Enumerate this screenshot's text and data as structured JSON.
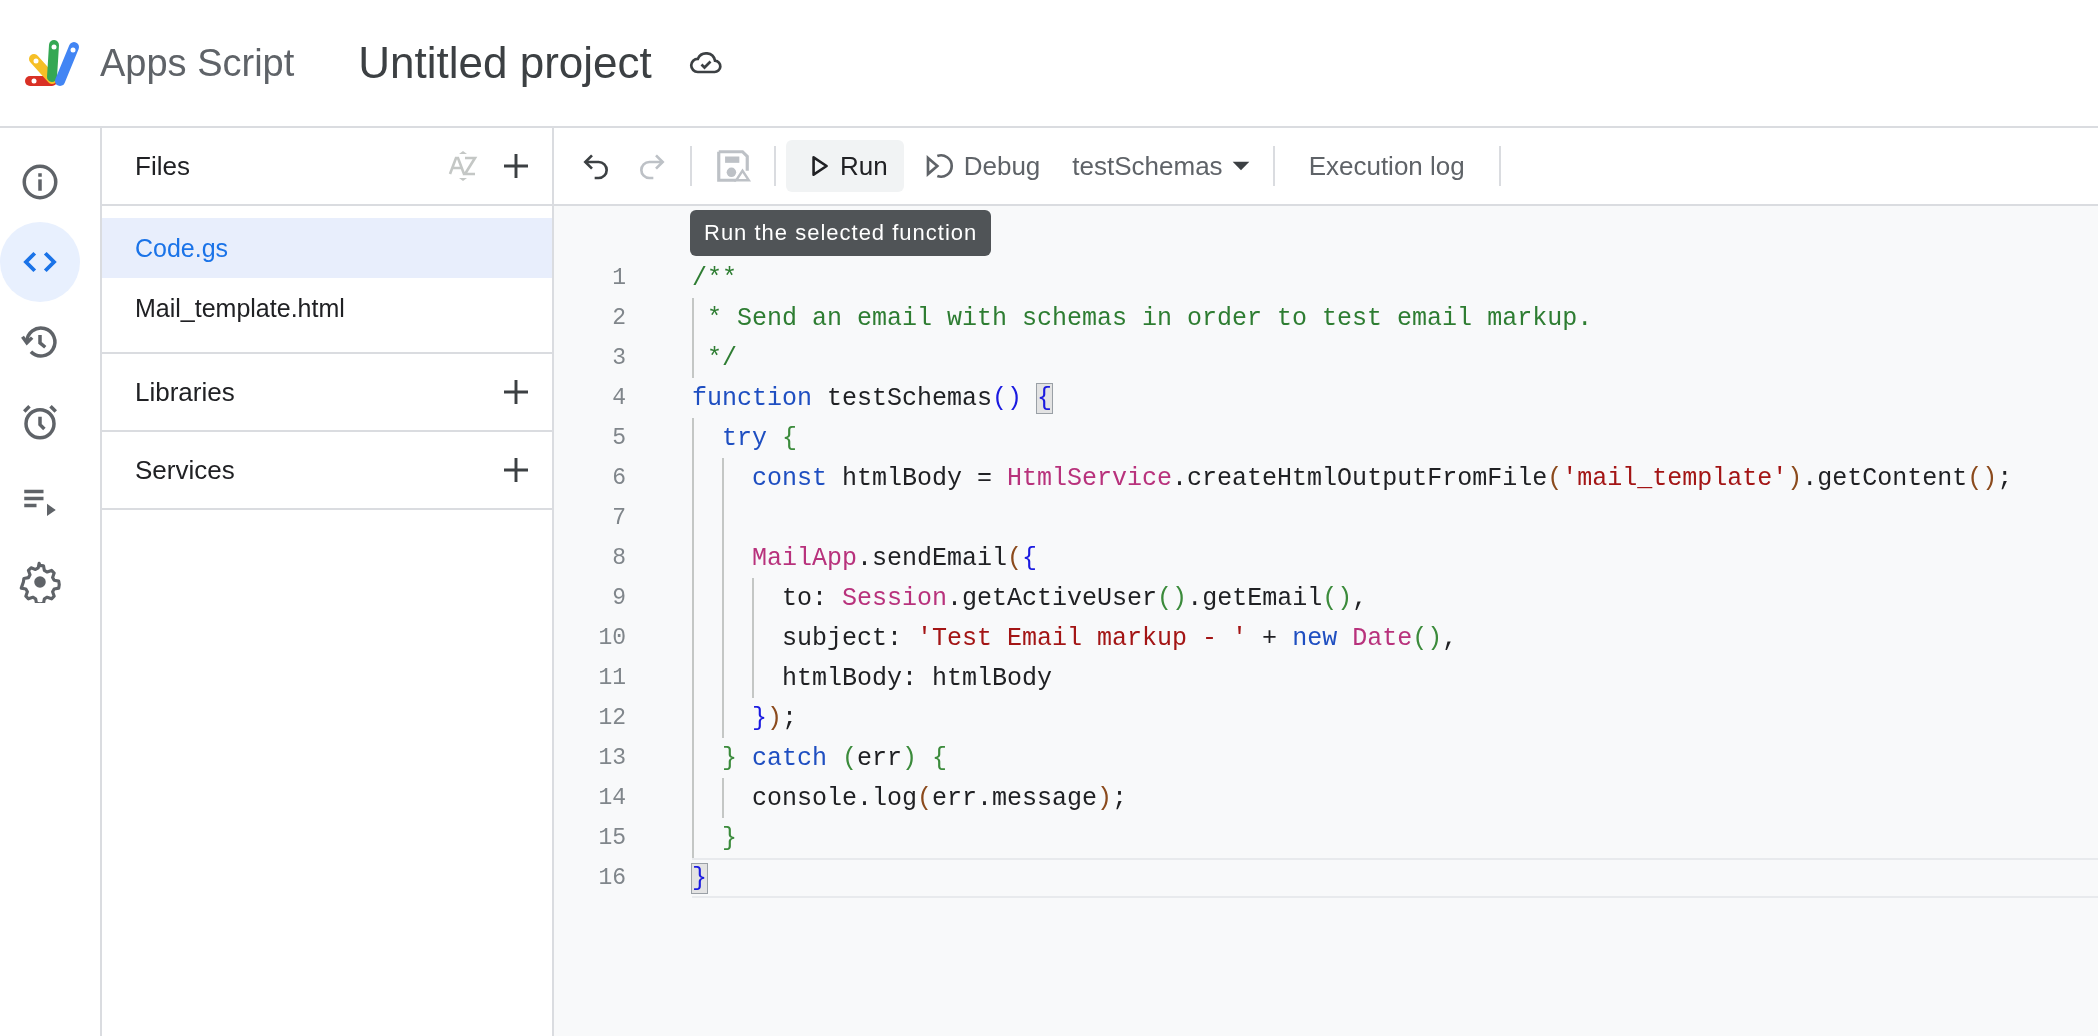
{
  "header": {
    "app_name": "Apps Script",
    "project_title": "Untitled project"
  },
  "rail": [
    {
      "kind": "info",
      "selected": false
    },
    {
      "kind": "code",
      "selected": true
    },
    {
      "kind": "history",
      "selected": false
    },
    {
      "kind": "triggers",
      "selected": false
    },
    {
      "kind": "executions",
      "selected": false
    },
    {
      "kind": "settings",
      "selected": false
    }
  ],
  "files_panel": {
    "title": "Files",
    "files": [
      {
        "name": "Code.gs",
        "selected": true
      },
      {
        "name": "Mail_template.html",
        "selected": false
      }
    ],
    "sections": [
      {
        "title": "Libraries"
      },
      {
        "title": "Services"
      }
    ]
  },
  "toolbar": {
    "undo": {
      "disabled": false
    },
    "redo": {
      "disabled": true
    },
    "save": {
      "disabled": true
    },
    "run_label": "Run",
    "debug_label": "Debug",
    "function_select": "testSchemas",
    "execution_log_label": "Execution log",
    "tooltip": "Run the selected function"
  },
  "editor": {
    "lines": [
      {
        "number": "1",
        "current": false,
        "tokens": [
          {
            "text": "/**",
            "kind": "comment"
          }
        ]
      },
      {
        "number": "2",
        "current": false,
        "tokens": [
          {
            "text": " * Send an email with schemas in order to test email markup.",
            "kind": "comment"
          }
        ]
      },
      {
        "number": "3",
        "current": false,
        "tokens": [
          {
            "text": " */",
            "kind": "comment"
          }
        ]
      },
      {
        "number": "4",
        "current": false,
        "tokens": [
          {
            "text": "function",
            "kind": "keyword"
          },
          {
            "text": " testSchemas",
            "kind": "plain"
          },
          {
            "text": "() ",
            "kind": "bracket1"
          },
          {
            "text": "{",
            "kind": "match"
          }
        ]
      },
      {
        "number": "5",
        "current": false,
        "tokens": [
          {
            "text": "  try",
            "kind": "keyword"
          },
          {
            "text": " {",
            "kind": "bracket2"
          }
        ]
      },
      {
        "number": "6",
        "current": false,
        "tokens": [
          {
            "text": "    const",
            "kind": "keyword"
          },
          {
            "text": " htmlBody = ",
            "kind": "plain"
          },
          {
            "text": "HtmlService",
            "kind": "builtin"
          },
          {
            "text": ".createHtmlOutputFromFile",
            "kind": "plain"
          },
          {
            "text": "(",
            "kind": "bracket3"
          },
          {
            "text": "'mail_template'",
            "kind": "string"
          },
          {
            "text": ")",
            "kind": "bracket3"
          },
          {
            "text": ".getContent",
            "kind": "plain"
          },
          {
            "text": "()",
            "kind": "bracket3"
          },
          {
            "text": ";",
            "kind": "plain"
          }
        ]
      },
      {
        "number": "7",
        "current": false
      },
      {
        "number": "8",
        "current": false,
        "tokens": [
          {
            "text": "    MailApp",
            "kind": "builtin"
          },
          {
            "text": ".sendEmail",
            "kind": "plain"
          },
          {
            "text": "(",
            "kind": "bracket3"
          },
          {
            "text": "{",
            "kind": "bracket1"
          }
        ]
      },
      {
        "number": "9",
        "current": false,
        "tokens": [
          {
            "text": "      to: ",
            "kind": "plain"
          },
          {
            "text": "Session",
            "kind": "builtin"
          },
          {
            "text": ".getActiveUser",
            "kind": "plain"
          },
          {
            "text": "()",
            "kind": "bracket2"
          },
          {
            "text": ".getEmail",
            "kind": "plain"
          },
          {
            "text": "()",
            "kind": "bracket2"
          },
          {
            "text": ",",
            "kind": "plain"
          }
        ]
      },
      {
        "number": "10",
        "current": false,
        "tokens": [
          {
            "text": "      subject: ",
            "kind": "plain"
          },
          {
            "text": "'Test Email markup - '",
            "kind": "string"
          },
          {
            "text": " + ",
            "kind": "plain"
          },
          {
            "text": "new",
            "kind": "keyword"
          },
          {
            "text": " Date",
            "kind": "builtin"
          },
          {
            "text": "()",
            "kind": "bracket2"
          },
          {
            "text": ",",
            "kind": "plain"
          }
        ]
      },
      {
        "number": "11",
        "current": false,
        "tokens": [
          {
            "text": "      htmlBody: htmlBody",
            "kind": "plain"
          }
        ]
      },
      {
        "number": "12",
        "current": false,
        "tokens": [
          {
            "text": "    }",
            "kind": "bracket1"
          },
          {
            "text": ")",
            "kind": "bracket3"
          },
          {
            "text": ";",
            "kind": "plain"
          }
        ]
      },
      {
        "number": "13",
        "current": false,
        "tokens": [
          {
            "text": "  }",
            "kind": "bracket2"
          },
          {
            "text": " catch",
            "kind": "keyword"
          },
          {
            "text": " (",
            "kind": "bracket2"
          },
          {
            "text": "err",
            "kind": "plain"
          },
          {
            "text": ")",
            "kind": "bracket2"
          },
          {
            "text": " {",
            "kind": "bracket2"
          }
        ]
      },
      {
        "number": "14",
        "current": false,
        "tokens": [
          {
            "text": "    console.log",
            "kind": "plain"
          },
          {
            "text": "(",
            "kind": "bracket3"
          },
          {
            "text": "err.message",
            "kind": "plain"
          },
          {
            "text": ")",
            "kind": "bracket3"
          },
          {
            "text": ";",
            "kind": "plain"
          }
        ]
      },
      {
        "number": "15",
        "current": false,
        "tokens": [
          {
            "text": "  }",
            "kind": "bracket2"
          }
        ]
      },
      {
        "number": "16",
        "current": true,
        "tokens": [
          {
            "text": "}",
            "kind": "match"
          }
        ]
      }
    ]
  }
}
